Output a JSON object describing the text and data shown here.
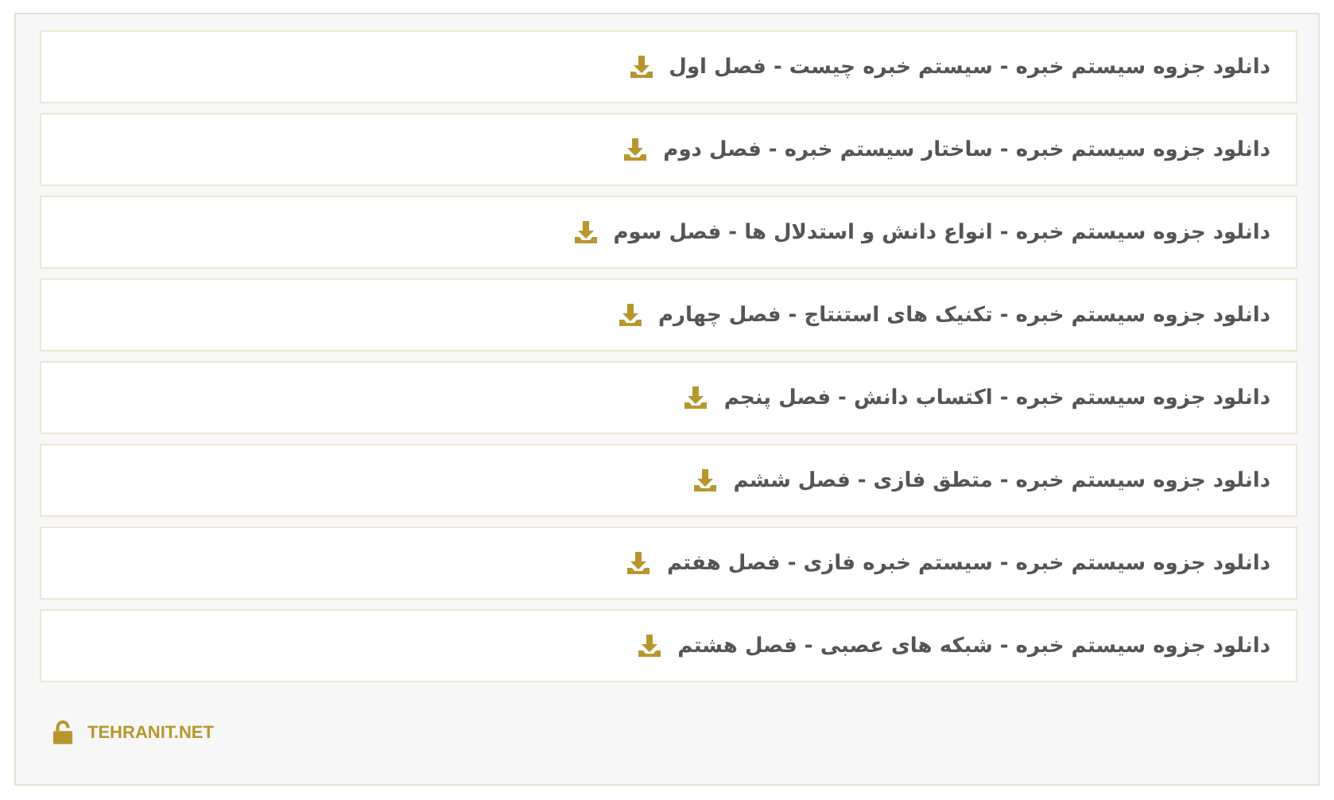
{
  "downloads": [
    {
      "label": "دانلود جزوه سیستم خبره - سیستم خبره چیست - فصل اول"
    },
    {
      "label": "دانلود جزوه سیستم خبره - ساختار سیستم خبره - فصل دوم"
    },
    {
      "label": "دانلود جزوه سیستم خبره - انواع دانش و استدلال ها - فصل سوم"
    },
    {
      "label": "دانلود جزوه سیستم خبره - تکنیک های استنتاج - فصل چهارم"
    },
    {
      "label": "دانلود جزوه سیستم خبره - اکتساب دانش - فصل پنجم"
    },
    {
      "label": "دانلود جزوه سیستم خبره - متطق فازی - فصل ششم"
    },
    {
      "label": "دانلود جزوه سیستم خبره - سیستم خبره فازی - فصل هفتم"
    },
    {
      "label": "دانلود جزوه سیستم خبره - شبکه های عصبی - فصل هشتم"
    }
  ],
  "footer": {
    "site": "TEHRANIT.NET"
  }
}
